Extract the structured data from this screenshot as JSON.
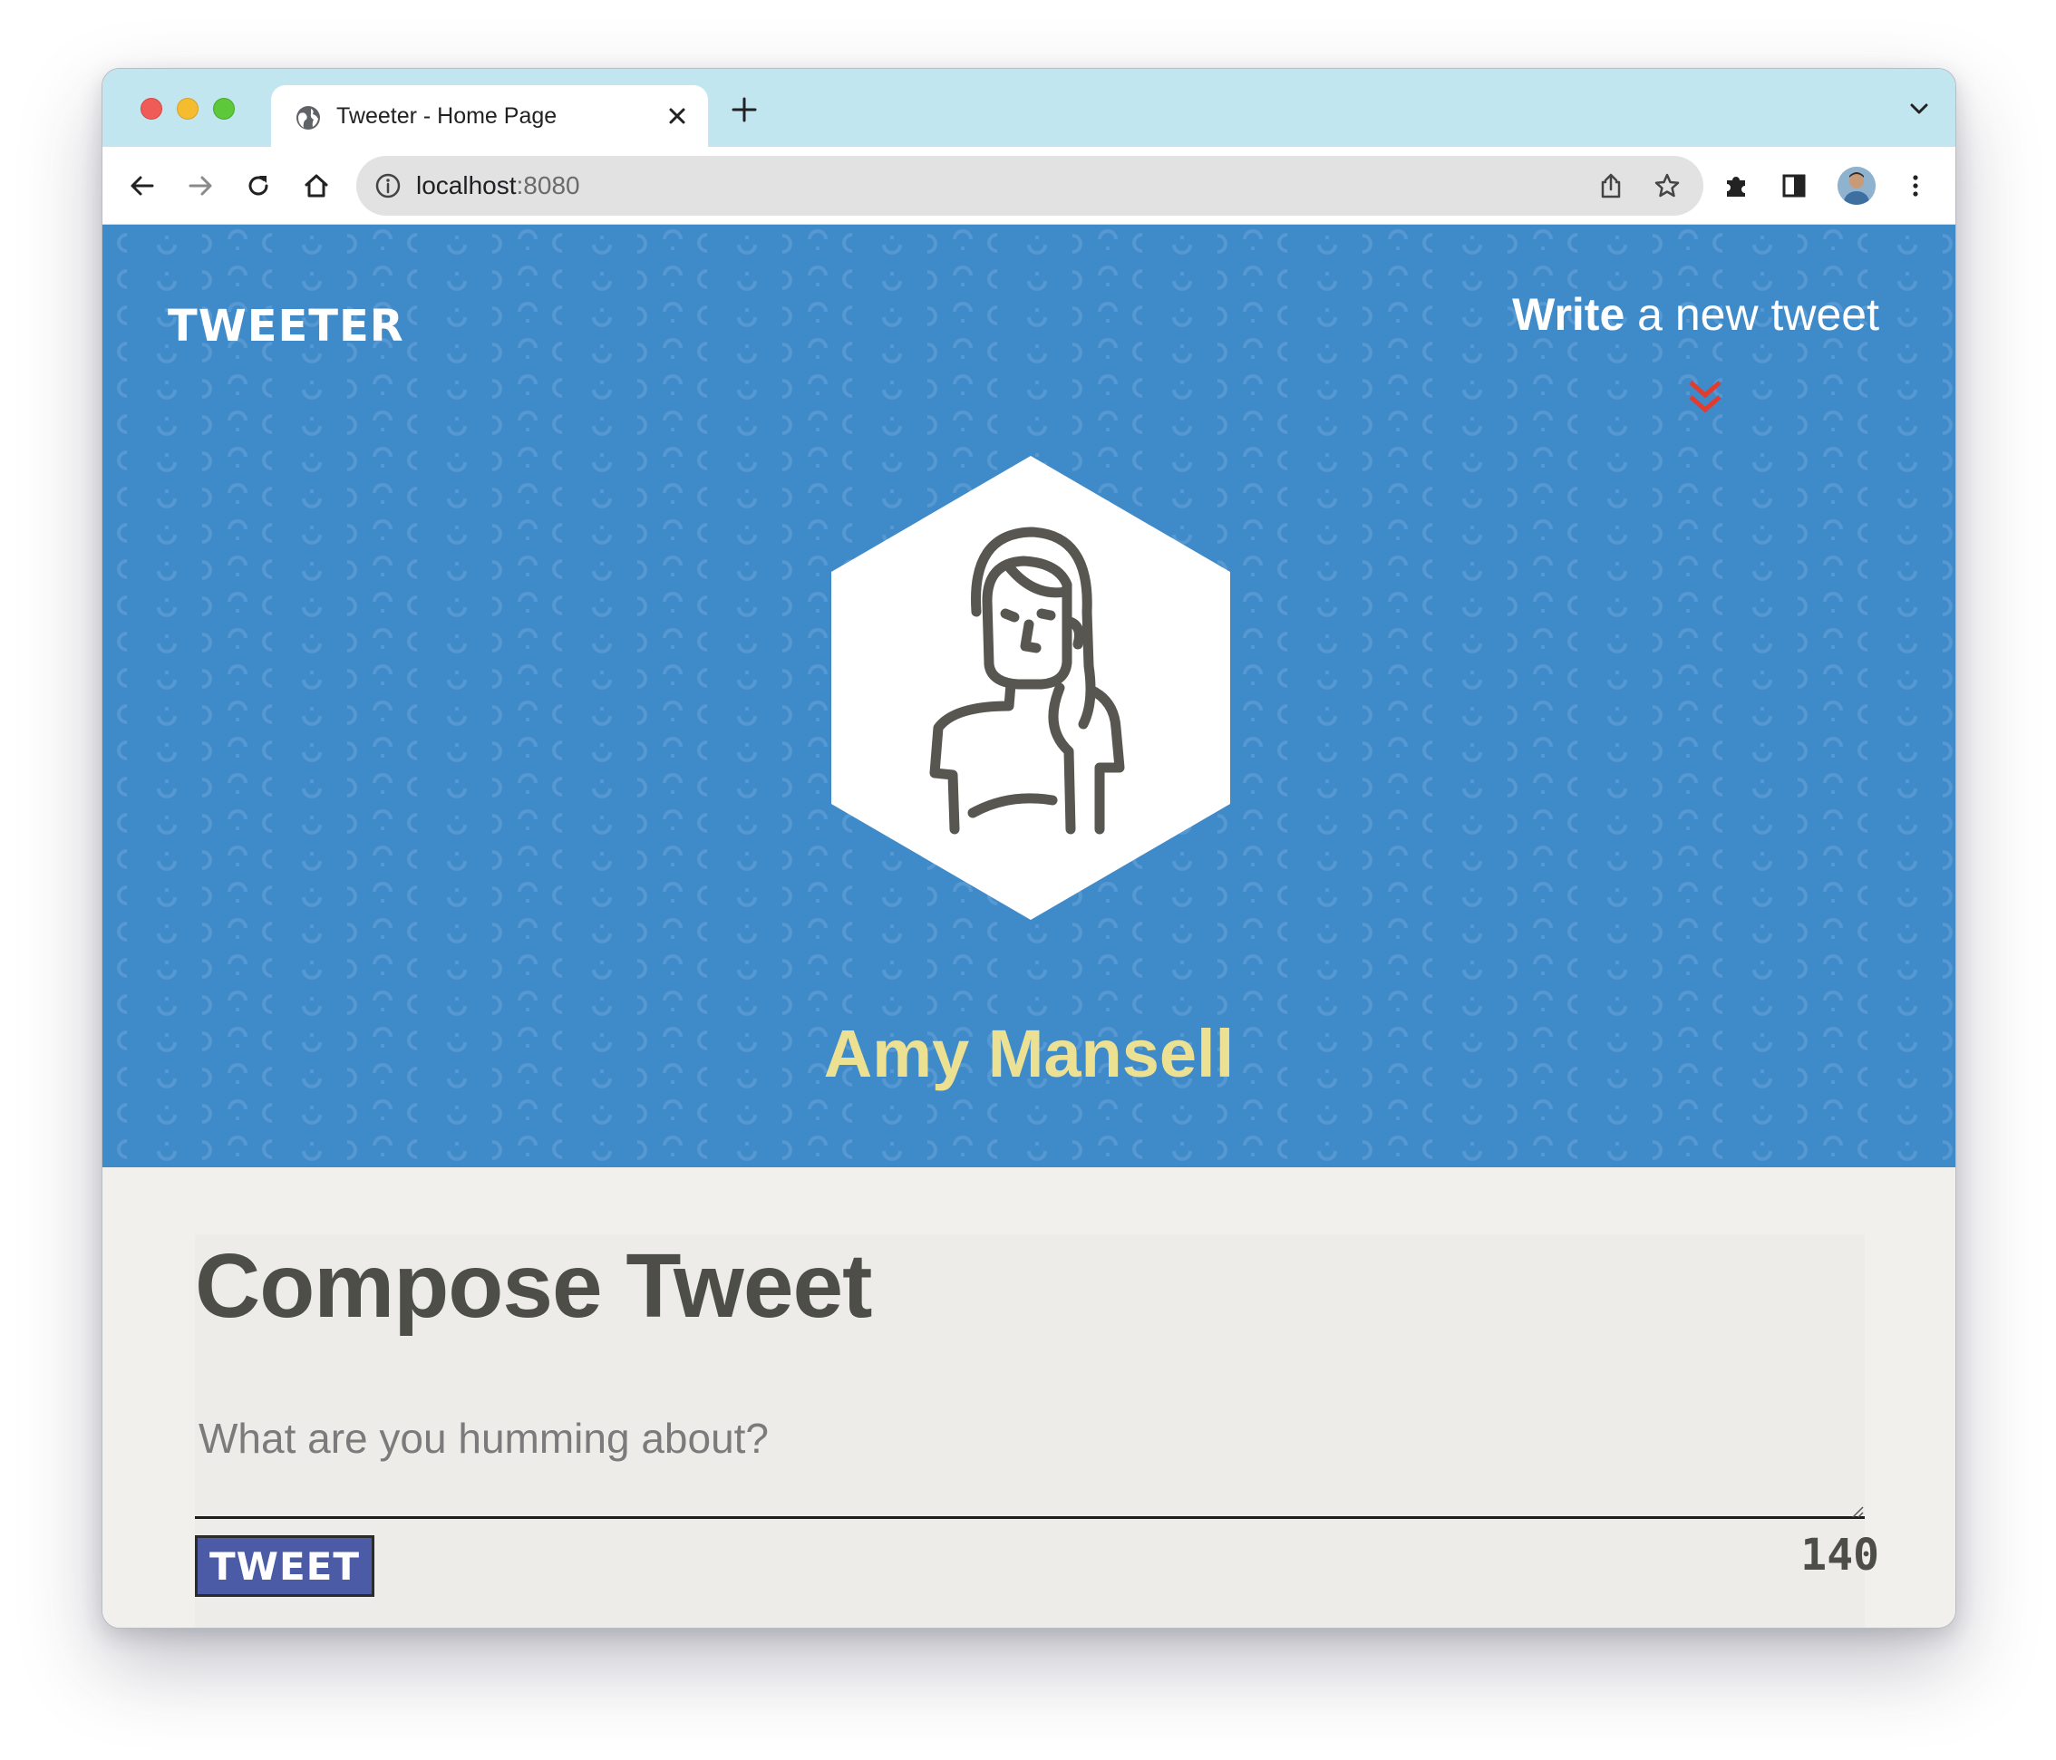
{
  "browser": {
    "tab_title": "Tweeter - Home Page",
    "url_host": "localhost",
    "url_port": ":8080"
  },
  "nav": {
    "brand": "TWEETER",
    "write_bold": "Write",
    "write_rest": " a new tweet"
  },
  "profile": {
    "name": "Amy Mansell"
  },
  "compose": {
    "title": "Compose Tweet",
    "placeholder": "What are you humming about?",
    "button": "TWEET",
    "counter": "140"
  },
  "colors": {
    "tab_strip": "#c1e6f0",
    "hero_blue": "#3f8ac9",
    "name_yellow": "#ece093",
    "arrow_red": "#e33b2e",
    "button_blue": "#4b5ba6",
    "text_dark": "#4e4e48"
  }
}
